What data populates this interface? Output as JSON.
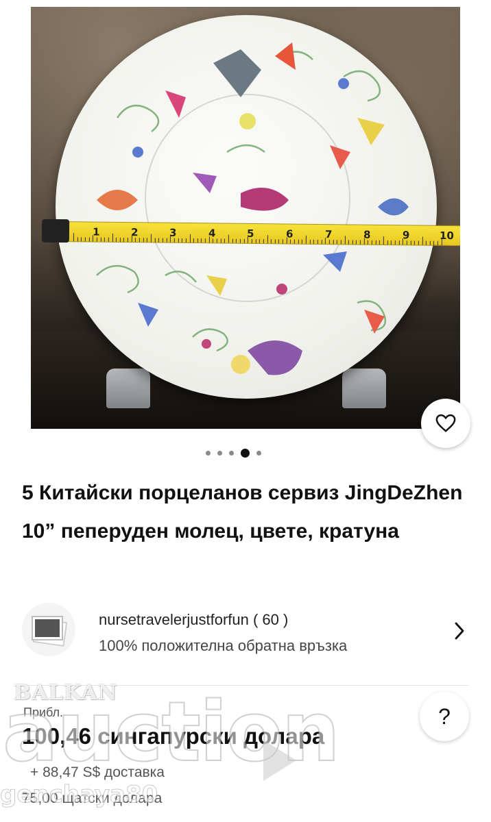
{
  "gallery": {
    "image_alt": "Porcelain plate with butterfly moth and flower pattern on stand with measuring tape",
    "ruler_numbers": [
      "1",
      "2",
      "3",
      "4",
      "5",
      "6",
      "7",
      "8",
      "9",
      "10"
    ],
    "dots_count": 5,
    "active_dot": 3
  },
  "listing": {
    "title": "5 Китайски порцеланов сервиз JingDeZhen 10” пеперуден молец, цвете, кратуна"
  },
  "seller": {
    "name": "nursetravelerjustforfun ( 60 )",
    "feedback": "100% положителна обратна връзка"
  },
  "price": {
    "approx_label": "Прибл.",
    "main": "100,46 сингапурски долара",
    "shipping": "+ 88,47 S$ доставка",
    "usd": "75,00 щатски долара"
  },
  "help": {
    "label": "?"
  },
  "watermark": {
    "brand_top": "BALKAN",
    "brand_main": "auction",
    "user": "genchaya80"
  },
  "colors": {
    "heart": "#111111",
    "ruler": "#f0d52c",
    "text": "#111111",
    "muted": "#555555"
  }
}
